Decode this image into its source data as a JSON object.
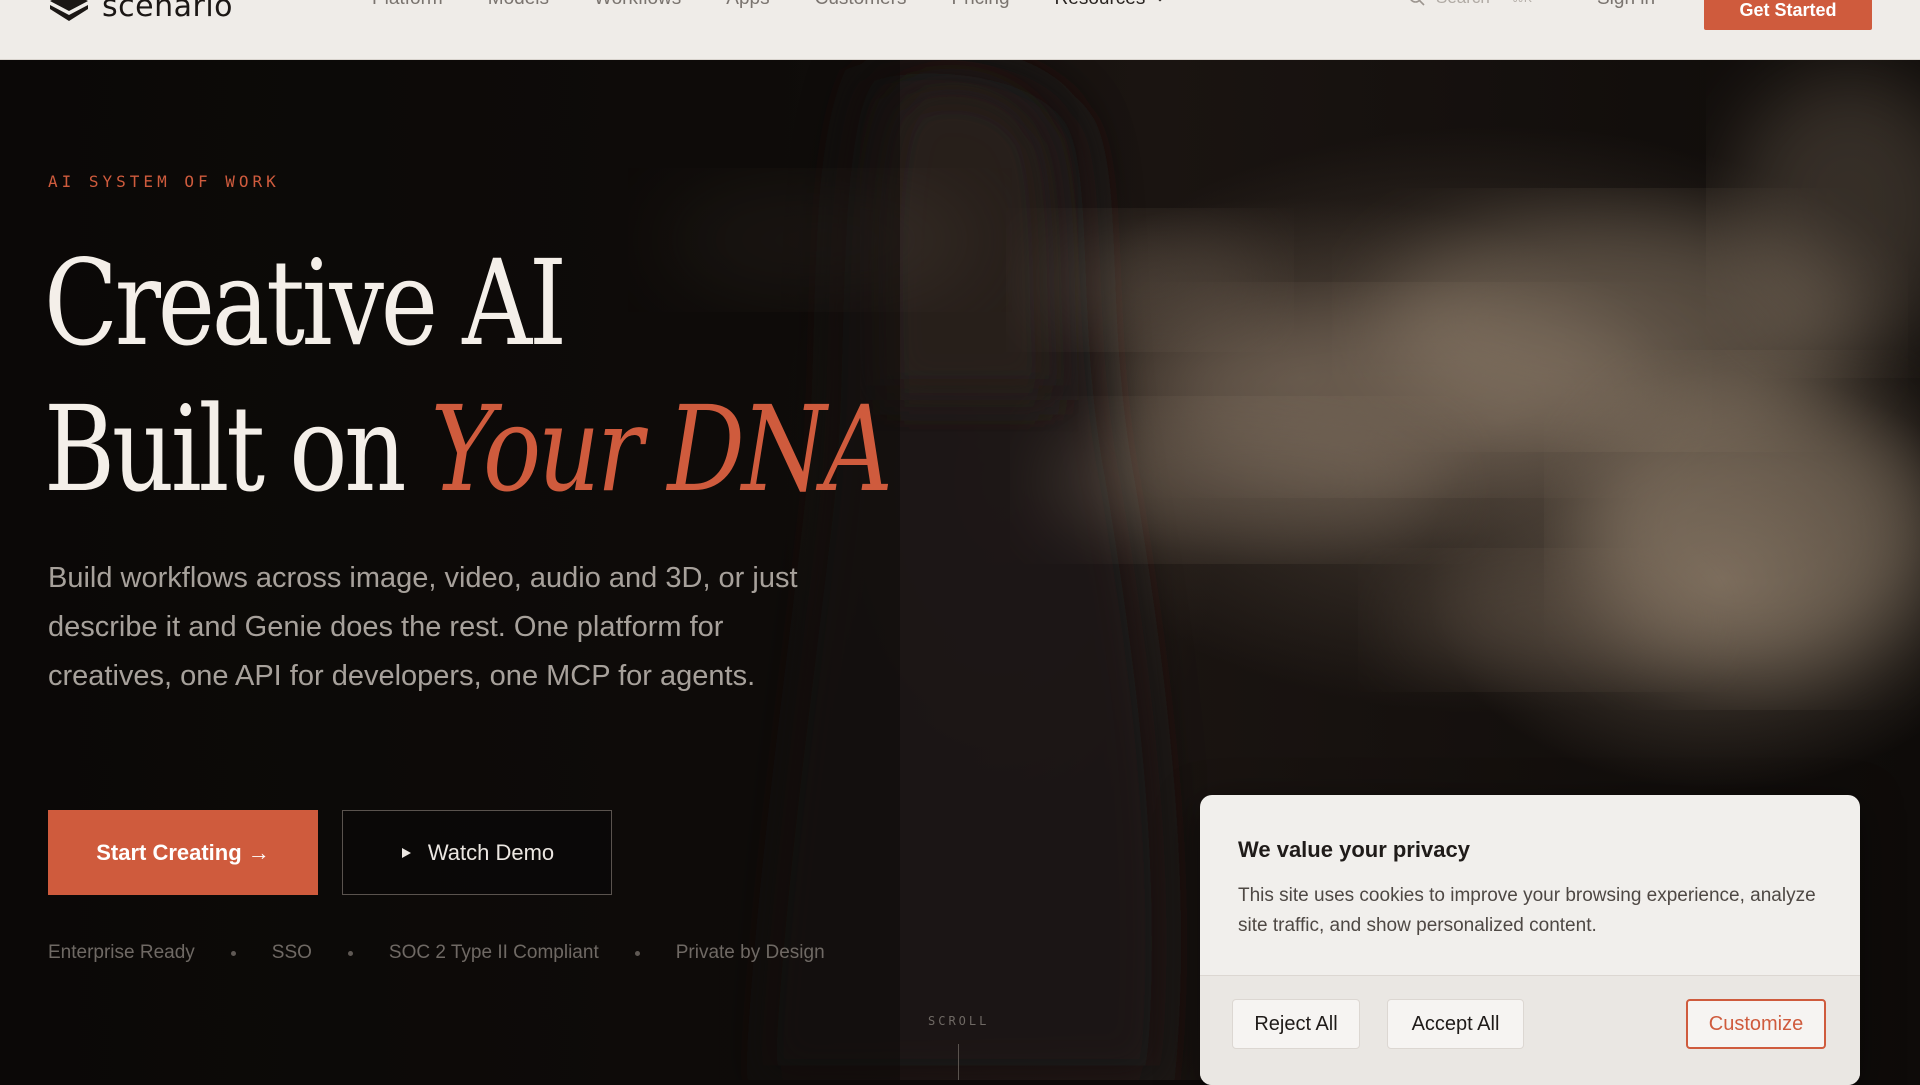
{
  "nav": {
    "brand": "scenario",
    "links": [
      "Platform",
      "Models",
      "Workflows",
      "Apps",
      "Customers",
      "Pricing"
    ],
    "resources_label": "Resources",
    "search_placeholder": "Search",
    "search_shortcut": "⌘K",
    "signin_label": "Sign in",
    "cta_label": "Get Started"
  },
  "hero": {
    "eyebrow": "AI SYSTEM OF WORK",
    "headline_line1": "Creative AI",
    "headline_line2_plain": "Built on ",
    "headline_line2_accent": "Your DNA",
    "subtitle": "Build workflows across image, video, audio and 3D, or just describe it and Genie does the rest. One platform for creatives, one API for developers, one MCP for agents.",
    "primary_button": "Start Creating →",
    "secondary_button": "Watch Demo",
    "badges": [
      "Enterprise Ready",
      "SSO",
      "SOC 2 Type II Compliant",
      "Private by Design"
    ],
    "scroll_label": "SCROLL"
  },
  "cookie": {
    "title": "We value your privacy",
    "text": "This site uses cookies to improve your browsing experience, analyze site traffic, and show personalized content.",
    "reject_label": "Reject All",
    "accept_label": "Accept All",
    "customize_label": "Customize"
  },
  "colors": {
    "accent": "#cf5b3d",
    "nav_bg": "#efece8",
    "hero_bg": "#0c0908",
    "cookie_bg": "#f1efec"
  },
  "icons": {
    "logo": "scenario-logo-icon",
    "search": "search-icon",
    "chevron": "chevron-down-icon",
    "play": "play-icon"
  }
}
